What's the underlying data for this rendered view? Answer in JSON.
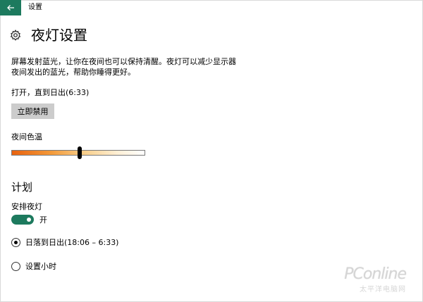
{
  "window": {
    "title": "设置"
  },
  "header": {
    "title": "夜灯设置"
  },
  "description": {
    "line1": "屏幕发射蓝光，让你在夜间也可以保持清醒。夜灯可以减少显示器",
    "line2": "夜间发出的蓝光，帮助你睡得更好。"
  },
  "status": {
    "text": "打开，直到日出(6:33)",
    "disable_button_label": "立即禁用"
  },
  "color_temperature": {
    "label": "夜间色温",
    "value_fraction": 0.51
  },
  "schedule": {
    "heading": "计划",
    "toggle_label": "安排夜灯",
    "toggle_state_text": "开",
    "toggle_on": true,
    "options": [
      {
        "label": "日落到日出(18:06 – 6:33)",
        "selected": true
      },
      {
        "label": "设置小时",
        "selected": false
      }
    ]
  },
  "watermark": {
    "brand": "PConline",
    "sub": "太平洋电脑网"
  },
  "colors": {
    "accent": "#1d7a5e",
    "button_bg": "#cccccc"
  },
  "icons": {
    "back": "back-arrow-icon",
    "settings": "gear-icon"
  }
}
